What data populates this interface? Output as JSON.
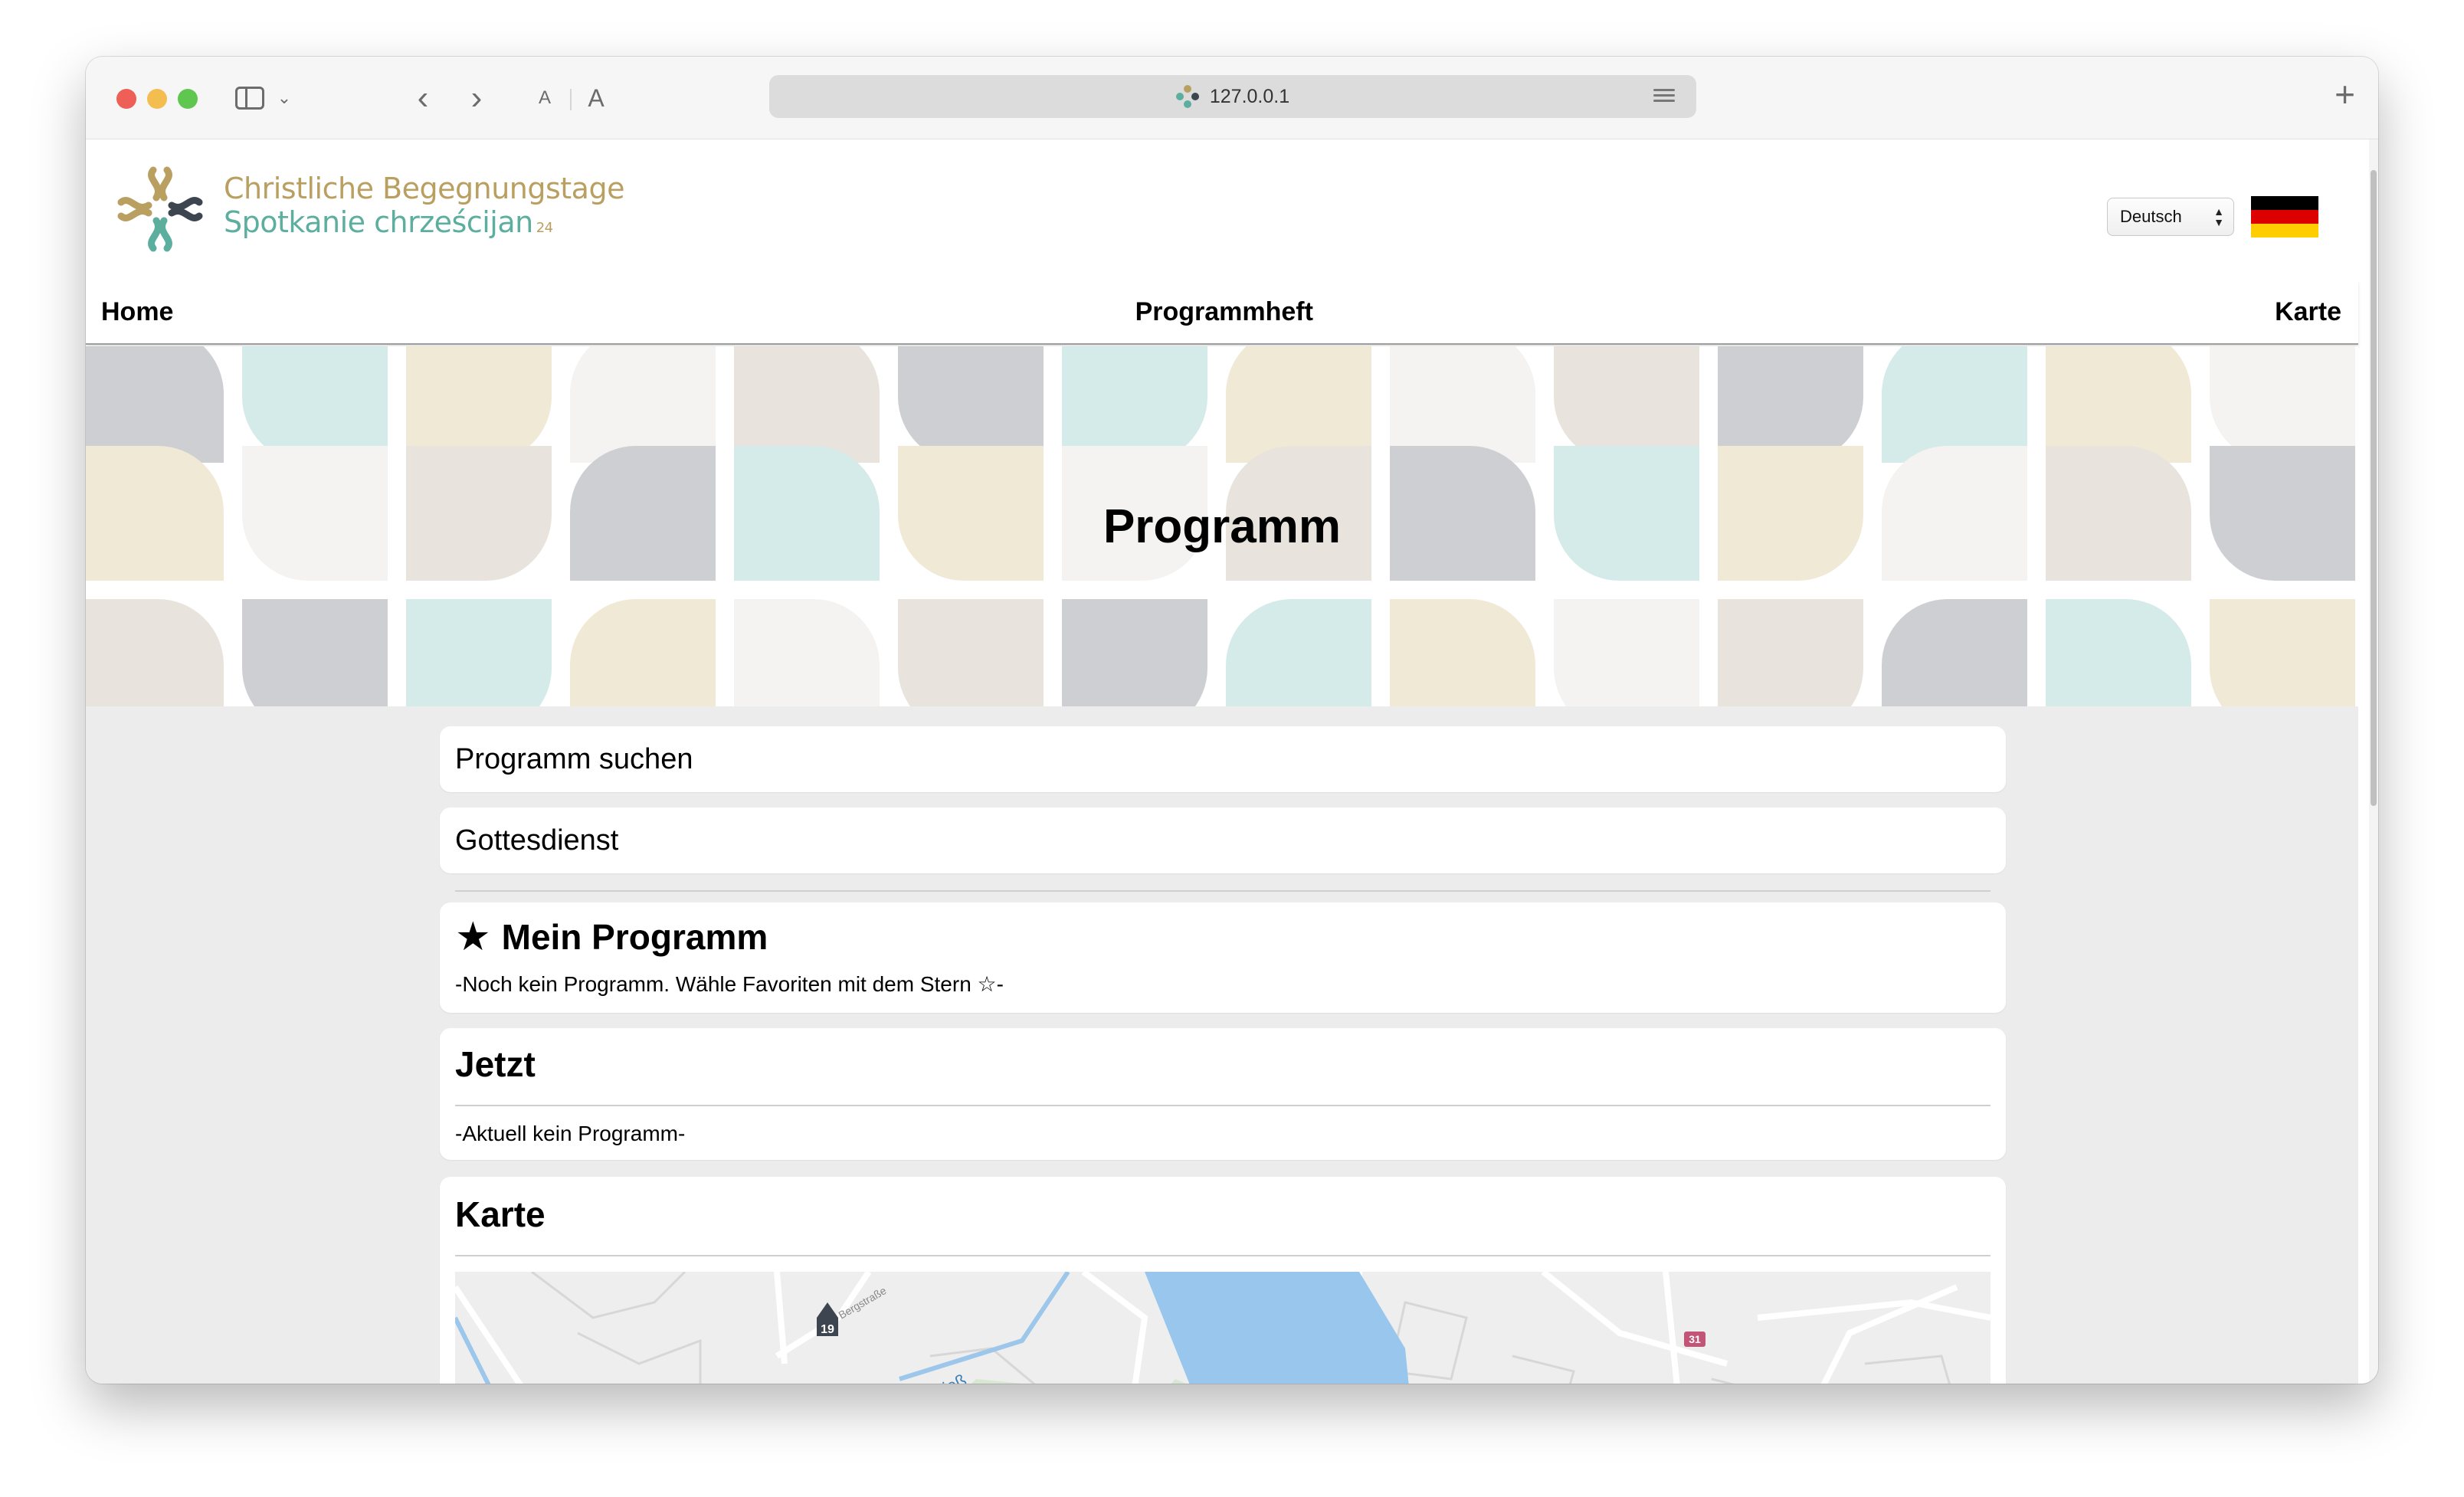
{
  "browser": {
    "url": "127.0.0.1",
    "icons": [
      "sidebar-icon",
      "chevron-down-icon",
      "back-icon",
      "forward-icon",
      "text-smaller-icon",
      "text-larger-icon",
      "reader-icon",
      "new-tab-icon"
    ],
    "font_small_label": "A",
    "font_large_label": "A",
    "new_tab_label": "+"
  },
  "site": {
    "logo_line1": "Christliche Begegnungstage",
    "logo_line2": "Spotkanie chrześcijan",
    "logo_sup": "24",
    "language": "Deutsch",
    "flag_colors": [
      "#000000",
      "#dd0000",
      "#ffce00"
    ]
  },
  "nav": {
    "home": "Home",
    "programmheft": "Programmheft",
    "karte": "Karte"
  },
  "hero": {
    "title": "Programm",
    "palette": [
      "#cdcfd3",
      "#f0e9d6",
      "#e8e4dd",
      "#d5ebe9",
      "#f4f3f1"
    ]
  },
  "sections": {
    "search": "Programm suchen",
    "category": "Gottesdienst",
    "my_program": {
      "title": "Mein Programm",
      "empty": "-Noch kein Programm. Wähle Favoriten mit dem Stern ☆-"
    },
    "now": {
      "title": "Jetzt",
      "empty": "-Aktuell kein Programm-"
    },
    "map": {
      "title": "Karte",
      "marker_19": "19",
      "marker_31": "31",
      "street_bergstrasse": "Bergstraße",
      "river_klingefliess": "Klingefließ"
    }
  }
}
